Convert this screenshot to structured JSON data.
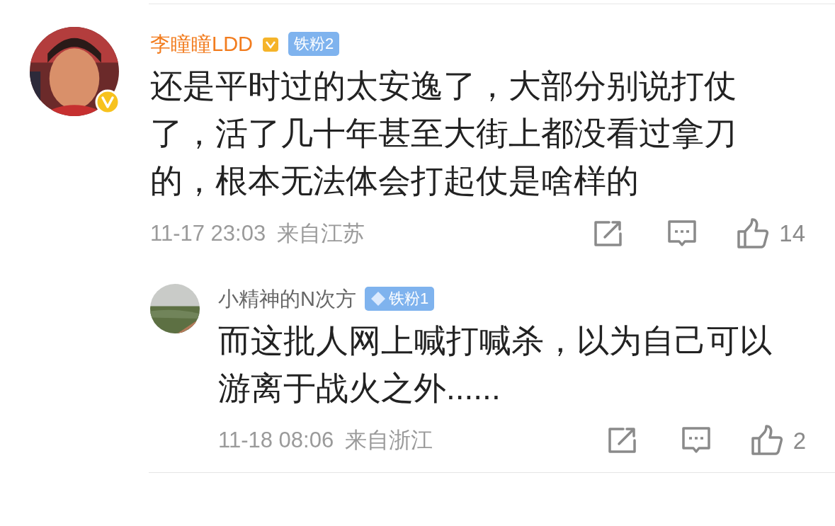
{
  "comment": {
    "author": "李瞳瞳LDD",
    "vip": true,
    "verified": true,
    "fan_badge": "铁粉2",
    "text": "还是平时过的太安逸了，大部分别说打仗了，活了几十年甚至大街上都没看过拿刀的，根本无法体会打起仗是啥样的",
    "time": "11-17 23:03",
    "location": "来自江苏",
    "likes": "14",
    "reply": {
      "author": "小精神的N次方",
      "vip": false,
      "verified": false,
      "fan_badge": "铁粉1",
      "text": "而这批人网上喊打喊杀，以为自己可以游离于战火之外......",
      "time": "11-18 08:06",
      "location": "来自浙江",
      "likes": "2"
    }
  }
}
